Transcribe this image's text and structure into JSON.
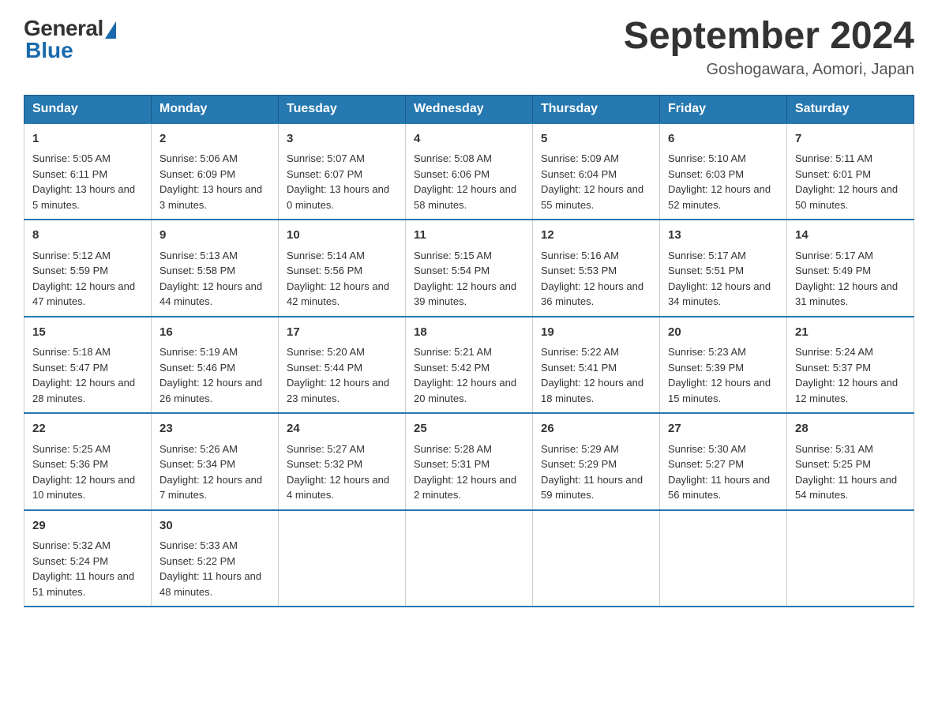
{
  "header": {
    "logo_general": "General",
    "logo_blue": "Blue",
    "title": "September 2024",
    "location": "Goshogawara, Aomori, Japan"
  },
  "calendar": {
    "days_of_week": [
      "Sunday",
      "Monday",
      "Tuesday",
      "Wednesday",
      "Thursday",
      "Friday",
      "Saturday"
    ],
    "weeks": [
      [
        {
          "day": "1",
          "sunrise": "5:05 AM",
          "sunset": "6:11 PM",
          "daylight": "13 hours and 5 minutes."
        },
        {
          "day": "2",
          "sunrise": "5:06 AM",
          "sunset": "6:09 PM",
          "daylight": "13 hours and 3 minutes."
        },
        {
          "day": "3",
          "sunrise": "5:07 AM",
          "sunset": "6:07 PM",
          "daylight": "13 hours and 0 minutes."
        },
        {
          "day": "4",
          "sunrise": "5:08 AM",
          "sunset": "6:06 PM",
          "daylight": "12 hours and 58 minutes."
        },
        {
          "day": "5",
          "sunrise": "5:09 AM",
          "sunset": "6:04 PM",
          "daylight": "12 hours and 55 minutes."
        },
        {
          "day": "6",
          "sunrise": "5:10 AM",
          "sunset": "6:03 PM",
          "daylight": "12 hours and 52 minutes."
        },
        {
          "day": "7",
          "sunrise": "5:11 AM",
          "sunset": "6:01 PM",
          "daylight": "12 hours and 50 minutes."
        }
      ],
      [
        {
          "day": "8",
          "sunrise": "5:12 AM",
          "sunset": "5:59 PM",
          "daylight": "12 hours and 47 minutes."
        },
        {
          "day": "9",
          "sunrise": "5:13 AM",
          "sunset": "5:58 PM",
          "daylight": "12 hours and 44 minutes."
        },
        {
          "day": "10",
          "sunrise": "5:14 AM",
          "sunset": "5:56 PM",
          "daylight": "12 hours and 42 minutes."
        },
        {
          "day": "11",
          "sunrise": "5:15 AM",
          "sunset": "5:54 PM",
          "daylight": "12 hours and 39 minutes."
        },
        {
          "day": "12",
          "sunrise": "5:16 AM",
          "sunset": "5:53 PM",
          "daylight": "12 hours and 36 minutes."
        },
        {
          "day": "13",
          "sunrise": "5:17 AM",
          "sunset": "5:51 PM",
          "daylight": "12 hours and 34 minutes."
        },
        {
          "day": "14",
          "sunrise": "5:17 AM",
          "sunset": "5:49 PM",
          "daylight": "12 hours and 31 minutes."
        }
      ],
      [
        {
          "day": "15",
          "sunrise": "5:18 AM",
          "sunset": "5:47 PM",
          "daylight": "12 hours and 28 minutes."
        },
        {
          "day": "16",
          "sunrise": "5:19 AM",
          "sunset": "5:46 PM",
          "daylight": "12 hours and 26 minutes."
        },
        {
          "day": "17",
          "sunrise": "5:20 AM",
          "sunset": "5:44 PM",
          "daylight": "12 hours and 23 minutes."
        },
        {
          "day": "18",
          "sunrise": "5:21 AM",
          "sunset": "5:42 PM",
          "daylight": "12 hours and 20 minutes."
        },
        {
          "day": "19",
          "sunrise": "5:22 AM",
          "sunset": "5:41 PM",
          "daylight": "12 hours and 18 minutes."
        },
        {
          "day": "20",
          "sunrise": "5:23 AM",
          "sunset": "5:39 PM",
          "daylight": "12 hours and 15 minutes."
        },
        {
          "day": "21",
          "sunrise": "5:24 AM",
          "sunset": "5:37 PM",
          "daylight": "12 hours and 12 minutes."
        }
      ],
      [
        {
          "day": "22",
          "sunrise": "5:25 AM",
          "sunset": "5:36 PM",
          "daylight": "12 hours and 10 minutes."
        },
        {
          "day": "23",
          "sunrise": "5:26 AM",
          "sunset": "5:34 PM",
          "daylight": "12 hours and 7 minutes."
        },
        {
          "day": "24",
          "sunrise": "5:27 AM",
          "sunset": "5:32 PM",
          "daylight": "12 hours and 4 minutes."
        },
        {
          "day": "25",
          "sunrise": "5:28 AM",
          "sunset": "5:31 PM",
          "daylight": "12 hours and 2 minutes."
        },
        {
          "day": "26",
          "sunrise": "5:29 AM",
          "sunset": "5:29 PM",
          "daylight": "11 hours and 59 minutes."
        },
        {
          "day": "27",
          "sunrise": "5:30 AM",
          "sunset": "5:27 PM",
          "daylight": "11 hours and 56 minutes."
        },
        {
          "day": "28",
          "sunrise": "5:31 AM",
          "sunset": "5:25 PM",
          "daylight": "11 hours and 54 minutes."
        }
      ],
      [
        {
          "day": "29",
          "sunrise": "5:32 AM",
          "sunset": "5:24 PM",
          "daylight": "11 hours and 51 minutes."
        },
        {
          "day": "30",
          "sunrise": "5:33 AM",
          "sunset": "5:22 PM",
          "daylight": "11 hours and 48 minutes."
        },
        null,
        null,
        null,
        null,
        null
      ]
    ]
  }
}
